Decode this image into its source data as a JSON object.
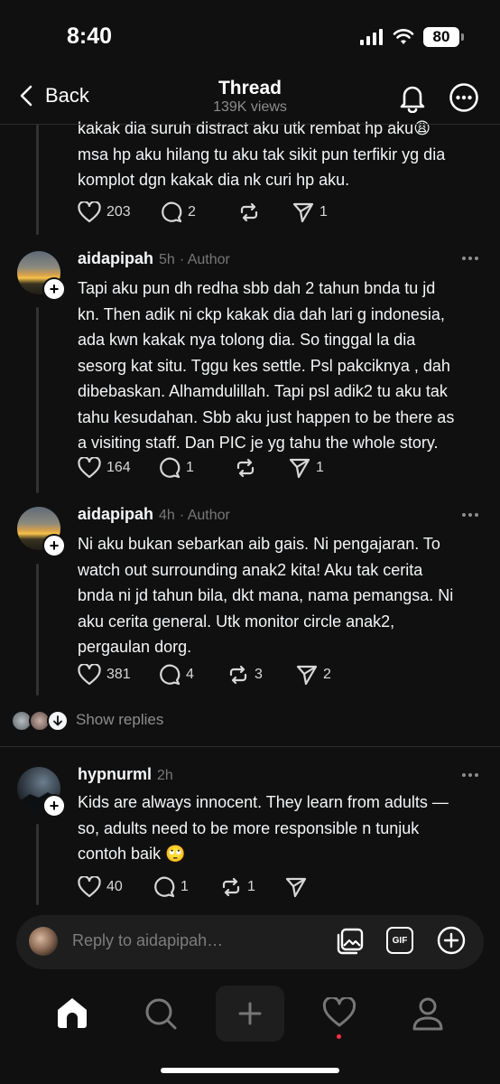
{
  "status_bar": {
    "time": "8:40",
    "battery": "80"
  },
  "header": {
    "back_label": "Back",
    "title": "Thread",
    "views": "139K views"
  },
  "posts": [
    {
      "text_lines": [
        "kakak dia suruh distract aku utk rembat hp aku😩",
        "msa hp aku hilang tu aku tak sikit pun terfikir yg dia",
        "komplot dgn kakak dia nk curi hp aku."
      ],
      "likes": "203",
      "replies": "2",
      "reposts": "",
      "shares": "1"
    },
    {
      "username": "aidapipah",
      "time": "5h",
      "role": "· Author",
      "text_lines": [
        "Tapi aku pun dh redha sbb dah 2 tahun bnda tu jd",
        "kn. Then adik ni ckp kakak dia dah lari g indonesia,",
        "ada kwn kakak nya tolong dia. So tinggal la dia",
        "sesorg kat situ. Tggu kes settle. Psl pakciknya , dah",
        "dibebaskan. Alhamdulillah. Tapi psl adik2 tu aku tak",
        "tahu kesudahan. Sbb aku just happen to be there as",
        "a visiting staff. Dan PIC je yg tahu the whole story."
      ],
      "likes": "164",
      "replies": "1",
      "reposts": "",
      "shares": "1"
    },
    {
      "username": "aidapipah",
      "time": "4h",
      "role": "· Author",
      "text_lines": [
        "Ni aku bukan sebarkan aib gais. Ni pengajaran. To",
        "watch out surrounding anak2 kita! Aku tak cerita",
        "bnda ni jd tahun bila, dkt mana, nama pemangsa. Ni",
        "aku cerita general. Utk monitor circle anak2,",
        "pergaulan dorg."
      ],
      "likes": "381",
      "replies": "4",
      "reposts": "3",
      "shares": "2"
    },
    {
      "username": "hypnurml",
      "time": "2h",
      "role": "",
      "text_lines": [
        "Kids are always innocent. They learn from adults —",
        "so, adults need to be more responsible n tunjuk",
        "contoh baik 🙄"
      ],
      "likes": "40",
      "replies": "1",
      "reposts": "1",
      "shares": ""
    }
  ],
  "show_replies_label": "Show replies",
  "reply_bar": {
    "placeholder": "Reply to aidapipah…",
    "gif_label": "GIF"
  },
  "icons": [
    "chevron-left-icon",
    "bell-icon",
    "more-icon",
    "heart-icon",
    "comment-icon",
    "repost-icon",
    "share-icon",
    "image-icon",
    "gif-icon",
    "add-icon",
    "home-icon",
    "search-icon",
    "plus-icon",
    "activity-icon",
    "profile-icon"
  ],
  "colors": {
    "background": "#101010",
    "text": "#f3f5f7",
    "muted": "#777777",
    "notification_dot": "#ff3040"
  }
}
